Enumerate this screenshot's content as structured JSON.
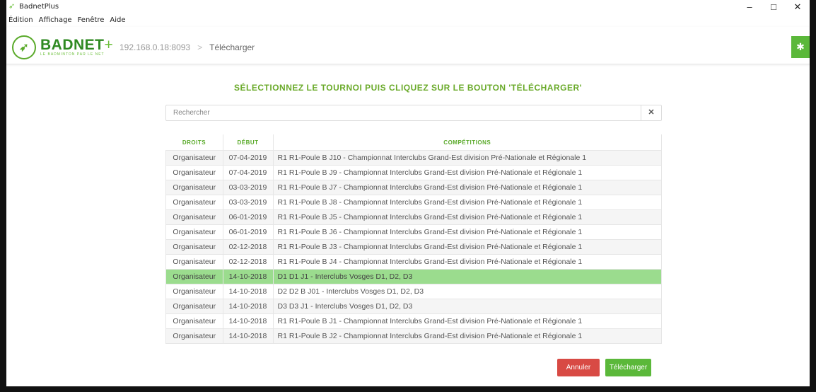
{
  "window": {
    "title": "BadnetPlus",
    "controls": {
      "minimize": "–",
      "maximize": "□",
      "close": "✕"
    }
  },
  "menu": [
    "Édition",
    "Affichage",
    "Fenêtre",
    "Aide"
  ],
  "navbar": {
    "logo_word": "BADNET",
    "logo_plus": "+",
    "logo_sub": "LE BADMINTON PAR LE NET",
    "host": "192.168.0.18:8093",
    "separator": ">",
    "page": "Télécharger"
  },
  "heading": "SÉLECTIONNEZ LE TOURNOI PUIS CLIQUEZ SUR LE BOUTON 'TÉLÉCHARGER'",
  "search": {
    "placeholder": "Rechercher",
    "clear": "✕"
  },
  "table": {
    "headers": [
      "DROITS",
      "DÉBUT",
      "COMPÉTITIONS"
    ],
    "selected_index": 8,
    "rows": [
      {
        "droits": "Organisateur",
        "debut": "07-04-2019",
        "competition": "R1 R1-Poule B J10 - Championnat Interclubs Grand-Est division Pré-Nationale et Régionale 1"
      },
      {
        "droits": "Organisateur",
        "debut": "07-04-2019",
        "competition": "R1 R1-Poule B J9 - Championnat Interclubs Grand-Est division Pré-Nationale et Régionale 1"
      },
      {
        "droits": "Organisateur",
        "debut": "03-03-2019",
        "competition": "R1 R1-Poule B J7 - Championnat Interclubs Grand-Est division Pré-Nationale et Régionale 1"
      },
      {
        "droits": "Organisateur",
        "debut": "03-03-2019",
        "competition": "R1 R1-Poule B J8 - Championnat Interclubs Grand-Est division Pré-Nationale et Régionale 1"
      },
      {
        "droits": "Organisateur",
        "debut": "06-01-2019",
        "competition": "R1 R1-Poule B J5 - Championnat Interclubs Grand-Est division Pré-Nationale et Régionale 1"
      },
      {
        "droits": "Organisateur",
        "debut": "06-01-2019",
        "competition": "R1 R1-Poule B J6 - Championnat Interclubs Grand-Est division Pré-Nationale et Régionale 1"
      },
      {
        "droits": "Organisateur",
        "debut": "02-12-2018",
        "competition": "R1 R1-Poule B J3 - Championnat Interclubs Grand-Est division Pré-Nationale et Régionale 1"
      },
      {
        "droits": "Organisateur",
        "debut": "02-12-2018",
        "competition": "R1 R1-Poule B J4 - Championnat Interclubs Grand-Est division Pré-Nationale et Régionale 1"
      },
      {
        "droits": "Organisateur",
        "debut": "14-10-2018",
        "competition": "D1 D1 J1 - Interclubs Vosges D1, D2, D3"
      },
      {
        "droits": "Organisateur",
        "debut": "14-10-2018",
        "competition": "D2 D2 B J01 - Interclubs Vosges D1, D2, D3"
      },
      {
        "droits": "Organisateur",
        "debut": "14-10-2018",
        "competition": "D3 D3 J1 - Interclubs Vosges D1, D2, D3"
      },
      {
        "droits": "Organisateur",
        "debut": "14-10-2018",
        "competition": "R1 R1-Poule B J1 - Championnat Interclubs Grand-Est division Pré-Nationale et Régionale 1"
      },
      {
        "droits": "Organisateur",
        "debut": "14-10-2018",
        "competition": "R1 R1-Poule B J2 - Championnat Interclubs Grand-Est division Pré-Nationale et Régionale 1"
      }
    ]
  },
  "buttons": {
    "cancel": "Annuler",
    "download": "Télécharger"
  },
  "colors": {
    "accent": "#5bb83a",
    "selected_row": "#9bdc8e",
    "danger": "#d84a44"
  },
  "icons": {
    "app": "shuttlecock-icon",
    "bug": "bug-icon",
    "clear": "close-icon"
  }
}
